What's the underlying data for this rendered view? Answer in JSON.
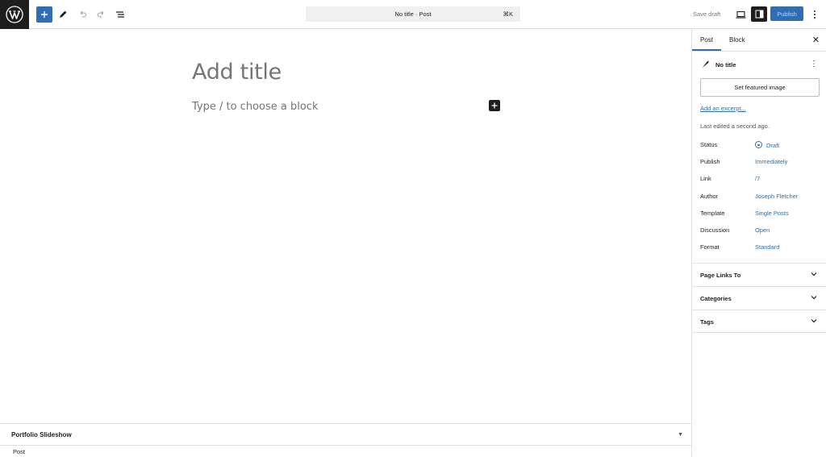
{
  "topbar": {
    "document_title": "No title · Post",
    "shortcut": "⌘K",
    "save_draft": "Save draft",
    "publish": "Publish"
  },
  "editor": {
    "title_placeholder": "Add title",
    "block_placeholder": "Type / to choose a block"
  },
  "metabox": {
    "title": "Portfolio Slideshow"
  },
  "footer": {
    "breadcrumb": "Post"
  },
  "sidebar": {
    "tabs": {
      "post": "Post",
      "block": "Block"
    },
    "header_title": "No title",
    "featured_image": "Set featured image",
    "excerpt_link": "Add an excerpt...",
    "last_edited": "Last edited a second ago.",
    "meta": [
      {
        "label": "Status",
        "value": "Draft"
      },
      {
        "label": "Publish",
        "value": "Immediately"
      },
      {
        "label": "Link",
        "value": "/7"
      },
      {
        "label": "Author",
        "value": "Joseph Fletcher"
      },
      {
        "label": "Template",
        "value": "Single Posts"
      },
      {
        "label": "Discussion",
        "value": "Open"
      },
      {
        "label": "Format",
        "value": "Standard"
      }
    ],
    "panels": [
      {
        "title": "Page Links To"
      },
      {
        "title": "Categories"
      },
      {
        "title": "Tags"
      }
    ]
  },
  "colors": {
    "accent": "#2f6db5",
    "dark": "#1e1e1e",
    "border": "#e0e0e0"
  }
}
